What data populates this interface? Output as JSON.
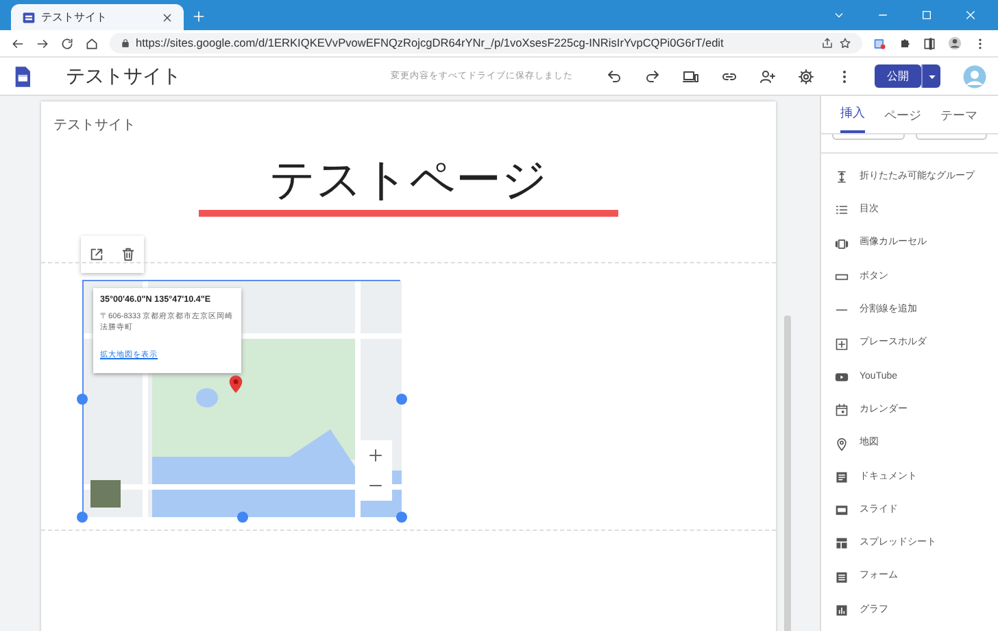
{
  "browser": {
    "tab": {
      "title": "テストサイト"
    },
    "url": "https://sites.google.com/d/1ERKIQKEVvPvowEFNQzRojcgDR64rYNr_/p/1voXsesF225cg-INRisIrYvpCQPi0G6rT/edit"
  },
  "app_bar": {
    "site_name": "テストサイト",
    "save_status": "変更内容をすべてドライブに保存しました",
    "publish_button": "公開"
  },
  "page": {
    "header_site_name": "テストサイト",
    "title": "テストページ",
    "map": {
      "coordinates": "35°00'46.0\"N 135°47'10.4\"E",
      "address": "〒606-8333 京都府京都市左京区岡崎法勝寺町",
      "link": "拡大地図を表示"
    }
  },
  "side_panel": {
    "tabs": [
      {
        "label": "挿入",
        "selected": true
      },
      {
        "label": "ページ",
        "selected": false
      },
      {
        "label": "テーマ",
        "selected": false
      }
    ],
    "items": [
      {
        "label": "折りたたみ可能なグループ"
      },
      {
        "label": "目次"
      },
      {
        "label": "画像カルーセル"
      },
      {
        "label": "ボタン"
      },
      {
        "label": "分割線を追加"
      },
      {
        "label": "プレースホルダ"
      },
      {
        "label": "YouTube"
      },
      {
        "label": "カレンダー"
      },
      {
        "label": "地図"
      },
      {
        "label": "ドキュメント"
      },
      {
        "label": "スライド"
      },
      {
        "label": "スプレッドシート"
      },
      {
        "label": "フォーム"
      },
      {
        "label": "グラフ"
      }
    ]
  }
}
